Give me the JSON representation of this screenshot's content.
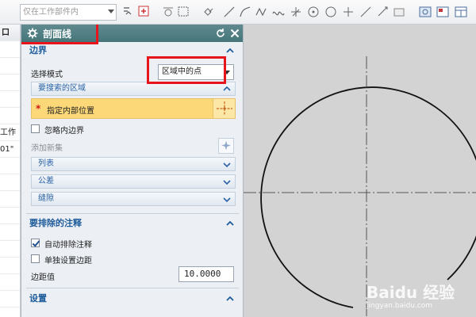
{
  "toolbar": {
    "filter_placeholder": "仅在工作部件内",
    "tool_icons": [
      "snap-point-icon",
      "point-on-curve-icon",
      "rectangle-select-icon",
      "grid-points-icon",
      "line-icon",
      "arc-icon",
      "spline-icon",
      "perpendicular-icon",
      "circle-center-icon",
      "circle-point-icon",
      "plus-point-icon",
      "tangent-icon",
      "point-icon",
      "view-icon",
      "layout-icon",
      "window-icon"
    ]
  },
  "left_panel": {
    "header": "口",
    "rows": [
      "",
      "",
      "",
      "",
      "",
      "工作",
      "01\"",
      "",
      "",
      "",
      "",
      "",
      "",
      "",
      "",
      "",
      ""
    ]
  },
  "dialog": {
    "title": "剖面线",
    "reset_icon": "reset-icon",
    "close_icon": "close-icon",
    "boundary": {
      "header": "边界",
      "mode_label": "选择模式",
      "mode_value": "区域中的点",
      "search_region_label": "要搜索的区域",
      "specify_point_label": "指定内部位置",
      "ignore_inner_label": "忽略内边界",
      "ignore_inner_checked": false,
      "add_set_label": "添加新集",
      "list_label": "列表",
      "tolerance_label": "公差",
      "gap_label": "缝隙"
    },
    "exclude": {
      "header": "要排除的注释",
      "auto_exclude_label": "自动排除注释",
      "auto_exclude_checked": true,
      "individual_margin_label": "单独设置边距",
      "individual_margin_checked": false,
      "margin_label": "边距值",
      "margin_value": "10.0000"
    },
    "settings": {
      "header": "设置"
    }
  },
  "canvas": {
    "watermark": "Baidu 经验",
    "watermark_sub": "jingyan.baidu.com"
  },
  "colors": {
    "accent": "#1e5b9a",
    "highlight": "#e8141b",
    "selection": "#fcd878",
    "titlebar": "#46767a"
  }
}
